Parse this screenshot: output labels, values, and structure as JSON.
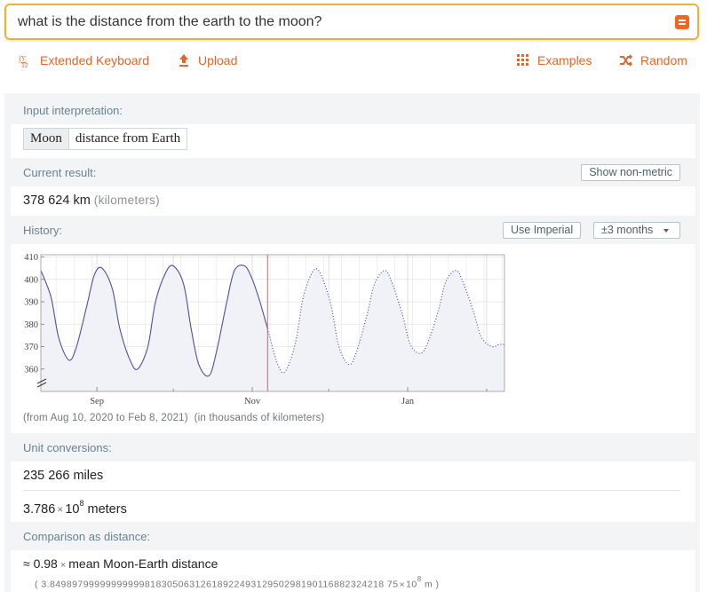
{
  "search": {
    "query": "what is the distance from the earth to the moon?"
  },
  "toolbar": {
    "extended_keyboard": "Extended Keyboard",
    "upload": "Upload",
    "examples": "Examples",
    "random": "Random"
  },
  "input_interpretation": {
    "title": "Input interpretation:",
    "key": "Moon",
    "value": "distance from Earth"
  },
  "current_result": {
    "title": "Current result:",
    "button": "Show non-metric",
    "value": "378 624 km",
    "unit": "(kilometers)"
  },
  "history": {
    "title": "History:",
    "imperial_button": "Use Imperial",
    "range_button": "±3 months",
    "caption_range": "(from Aug 10, 2020 to Feb 8, 2021)",
    "caption_units": "(in thousands of kilometers)"
  },
  "chart_data": {
    "type": "line",
    "xlabel": "",
    "ylabel": "",
    "x_tick_labels": [
      "Sep",
      "Nov",
      "Jan"
    ],
    "y_tick_labels": [
      "360",
      "370",
      "380",
      "390",
      "400",
      "410"
    ],
    "ylim": [
      350,
      411
    ],
    "axis_break": true,
    "current_marker": "Nov 7, 2020",
    "grid": true,
    "series": [
      {
        "style": "solid",
        "x": [
          "2020-08-10",
          "2020-08-14",
          "2020-08-17",
          "2020-08-21",
          "2020-08-24",
          "2020-08-28",
          "2020-08-31",
          "2020-09-03",
          "2020-09-07",
          "2020-09-10",
          "2020-09-14",
          "2020-09-17",
          "2020-09-21",
          "2020-09-24",
          "2020-09-28",
          "2020-10-01",
          "2020-10-05",
          "2020-10-08",
          "2020-10-11",
          "2020-10-15",
          "2020-10-18",
          "2020-10-22",
          "2020-10-25",
          "2020-10-29",
          "2020-11-01",
          "2020-11-04",
          "2020-11-07"
        ],
        "values": [
          404,
          392,
          374,
          364,
          370,
          388,
          402,
          405,
          396,
          378,
          364,
          360,
          370,
          390,
          403,
          406,
          398,
          378,
          362,
          357,
          368,
          390,
          404,
          406,
          400,
          390,
          378
        ]
      },
      {
        "style": "dotted",
        "x": [
          "2020-11-07",
          "2020-11-11",
          "2020-11-14",
          "2020-11-18",
          "2020-11-21",
          "2020-11-25",
          "2020-11-28",
          "2020-12-02",
          "2020-12-05",
          "2020-12-09",
          "2020-12-12",
          "2020-12-16",
          "2020-12-19",
          "2020-12-23",
          "2020-12-26",
          "2020-12-30",
          "2021-01-02",
          "2021-01-06",
          "2021-01-09",
          "2021-01-13",
          "2021-01-16",
          "2021-01-20",
          "2021-01-23",
          "2021-01-27",
          "2021-01-30",
          "2021-02-03",
          "2021-02-06",
          "2021-02-08"
        ],
        "values": [
          378,
          362,
          359,
          372,
          392,
          404,
          402,
          388,
          370,
          362,
          368,
          384,
          398,
          404,
          398,
          384,
          371,
          367,
          372,
          386,
          399,
          404,
          398,
          385,
          374,
          370,
          371,
          371
        ]
      }
    ]
  },
  "unit_conversions": {
    "title": "Unit conversions:",
    "miles_value": "235 266 miles",
    "meters_mantissa": "3.786",
    "times": "×",
    "meters_base": "10",
    "meters_exp": "8",
    "meters_unit": "meters"
  },
  "comparison": {
    "title": "Comparison as distance:",
    "approx": "≈",
    "factor": "0.98",
    "times": "×",
    "label": "mean Moon-Earth distance",
    "detail_mantissa": "( 3.849897999999999998183050631261892249312950298190116882324218 75",
    "detail_times": "×",
    "detail_base": "10",
    "detail_exp": "8",
    "detail_unit": "m )"
  },
  "colors": {
    "accent": "#e9642a",
    "search_border": "#f0b136",
    "pod_header_bg": "#f2f4f5",
    "pod_title": "#6a8190",
    "line": "#4d4f9c",
    "fill": "#f1f1f8",
    "marker": "#e0585a"
  }
}
